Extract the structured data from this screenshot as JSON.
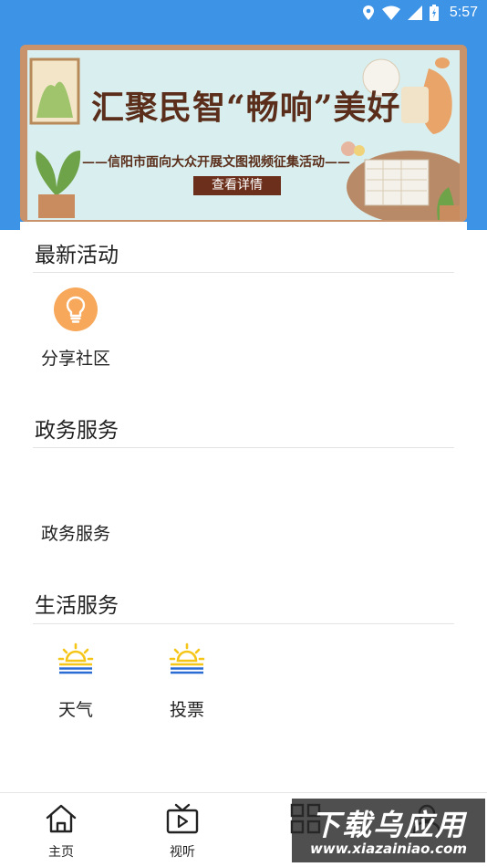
{
  "status_bar": {
    "time": "5:57"
  },
  "banner": {
    "title": "汇聚民智“畅响”美好",
    "subtitle": "——信阳市面向大众开展文图视频征集活动——",
    "button_label": "查看详情"
  },
  "sections": [
    {
      "title": "最新活动",
      "items": [
        {
          "label": "分享社区",
          "icon": "lightbulb-icon"
        }
      ]
    },
    {
      "title": "政务服务",
      "items": [
        {
          "label": "政务服务",
          "icon": ""
        }
      ]
    },
    {
      "title": "生活服务",
      "items": [
        {
          "label": "天气",
          "icon": "sunrise-icon"
        },
        {
          "label": "投票",
          "icon": "sunrise-icon"
        }
      ]
    }
  ],
  "bottom_nav": [
    {
      "label": "主页",
      "icon": "home-icon"
    },
    {
      "label": "视听",
      "icon": "tv-play-icon"
    },
    {
      "label": "",
      "icon": "grid-icon"
    },
    {
      "label": "",
      "icon": "user-icon"
    }
  ],
  "watermark": {
    "line1": "下载乌应用",
    "line2": "www.xiazainiao.com"
  },
  "colors": {
    "header_blue": "#3d93e6",
    "accent_orange": "#f7a85a",
    "sun_yellow": "#f5c518",
    "water_blue": "#2b6cd4"
  }
}
